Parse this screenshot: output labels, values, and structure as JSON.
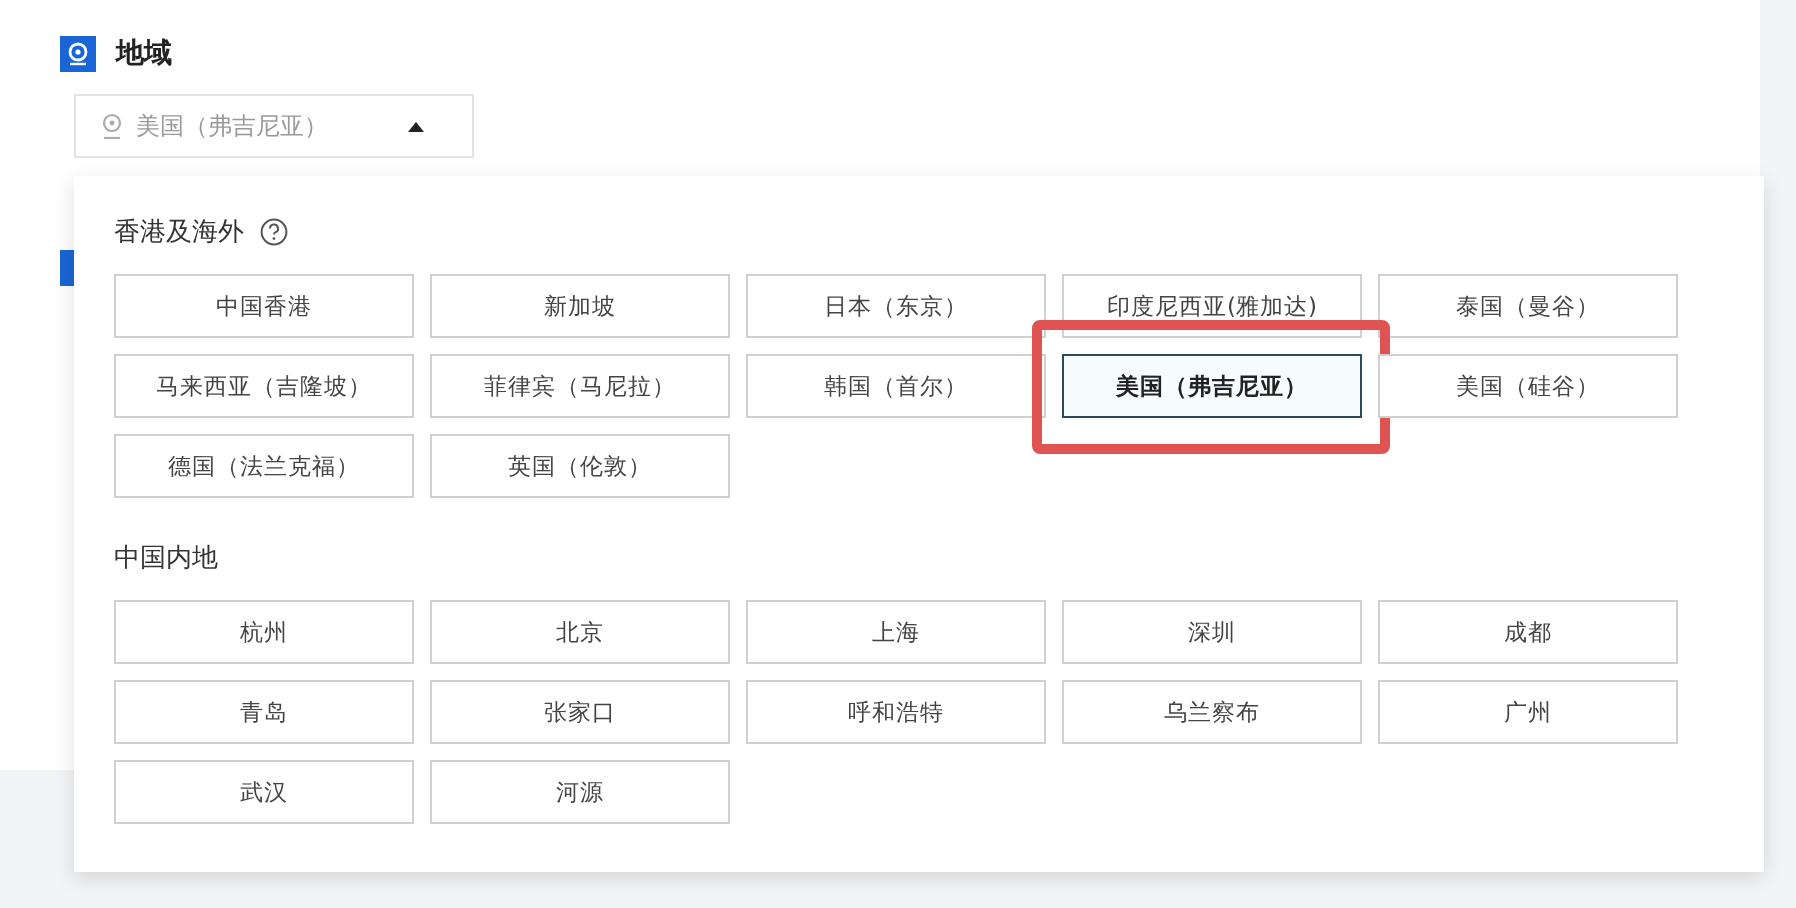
{
  "region": {
    "title": "地域",
    "value": "美国（弗吉尼亚）",
    "expanded": true
  },
  "groups": [
    {
      "title": "香港及海外",
      "help": true,
      "options": [
        {
          "label": "中国香港",
          "selected": false
        },
        {
          "label": "新加坡",
          "selected": false
        },
        {
          "label": "日本（东京）",
          "selected": false
        },
        {
          "label": "印度尼西亚(雅加达)",
          "selected": false
        },
        {
          "label": "泰国（曼谷）",
          "selected": false
        },
        {
          "label": "马来西亚（吉隆坡）",
          "selected": false
        },
        {
          "label": "菲律宾（马尼拉）",
          "selected": false
        },
        {
          "label": "韩国（首尔）",
          "selected": false
        },
        {
          "label": "美国（弗吉尼亚）",
          "selected": true
        },
        {
          "label": "美国（硅谷）",
          "selected": false
        },
        {
          "label": "德国（法兰克福）",
          "selected": false
        },
        {
          "label": "英国（伦敦）",
          "selected": false
        }
      ]
    },
    {
      "title": "中国内地",
      "help": false,
      "options": [
        {
          "label": "杭州",
          "selected": false
        },
        {
          "label": "北京",
          "selected": false
        },
        {
          "label": "上海",
          "selected": false
        },
        {
          "label": "深圳",
          "selected": false
        },
        {
          "label": "成都",
          "selected": false
        },
        {
          "label": "青岛",
          "selected": false
        },
        {
          "label": "张家口",
          "selected": false
        },
        {
          "label": "呼和浩特",
          "selected": false
        },
        {
          "label": "乌兰察布",
          "selected": false
        },
        {
          "label": "广州",
          "selected": false
        },
        {
          "label": "武汉",
          "selected": false
        },
        {
          "label": "河源",
          "selected": false
        }
      ]
    }
  ]
}
